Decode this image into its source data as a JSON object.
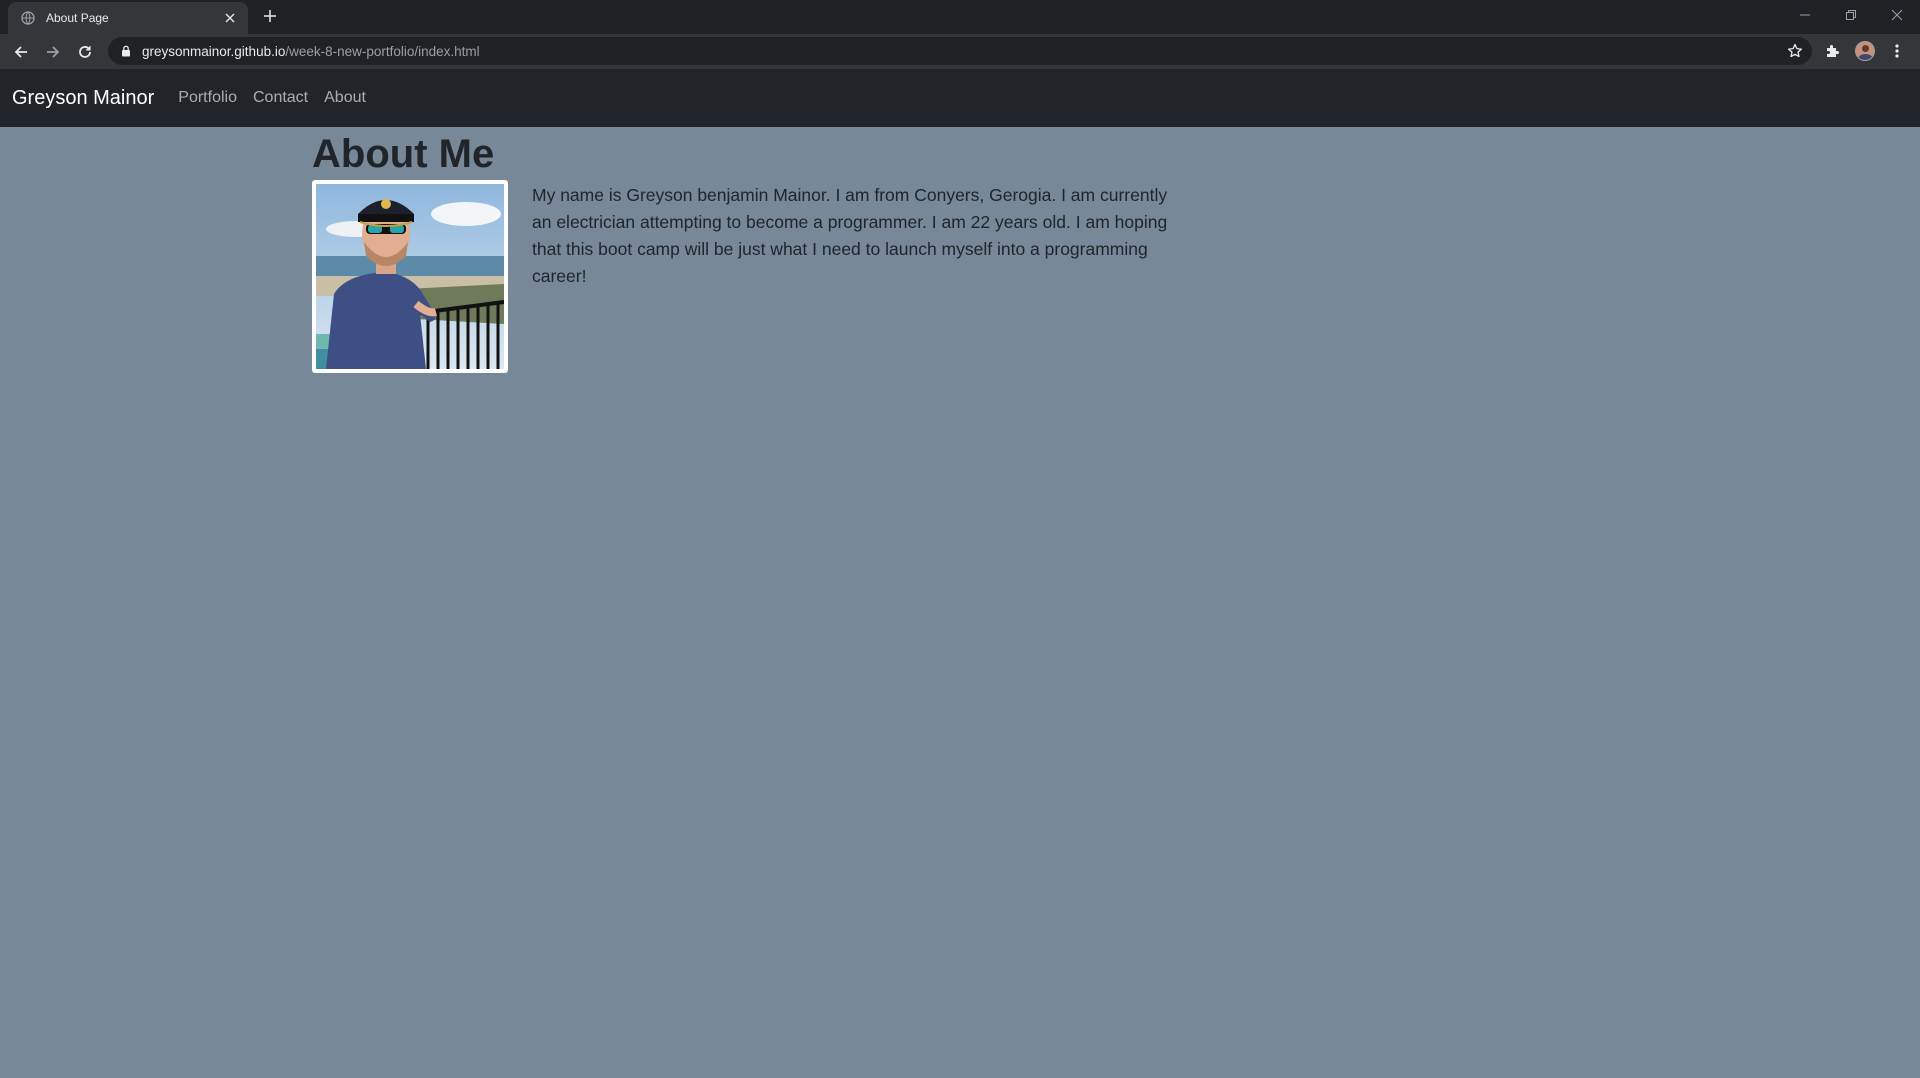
{
  "browser": {
    "tab": {
      "title": "About Page"
    },
    "url": {
      "host": "greysonmainor.github.io",
      "path": "/week-8-new-portfolio/index.html"
    }
  },
  "navbar": {
    "brand": "Greyson Mainor",
    "links": [
      "Portfolio",
      "Contact",
      "About"
    ]
  },
  "main": {
    "heading": "About Me",
    "bio": "My name is Greyson benjamin Mainor. I am from Conyers, Gerogia. I am currently an electrician attempting to become a programmer. I am 22 years old. I am hoping that this boot camp will be just what I need to launch myself into a programming career!"
  },
  "colors": {
    "page_background": "#778899",
    "navbar_background": "#212529",
    "text": "#212529"
  },
  "icons": [
    "globe-icon",
    "close-icon",
    "plus-icon",
    "back-icon",
    "forward-icon",
    "reload-icon",
    "lock-icon",
    "star-icon",
    "puzzle-icon",
    "kebab-menu-icon"
  ]
}
